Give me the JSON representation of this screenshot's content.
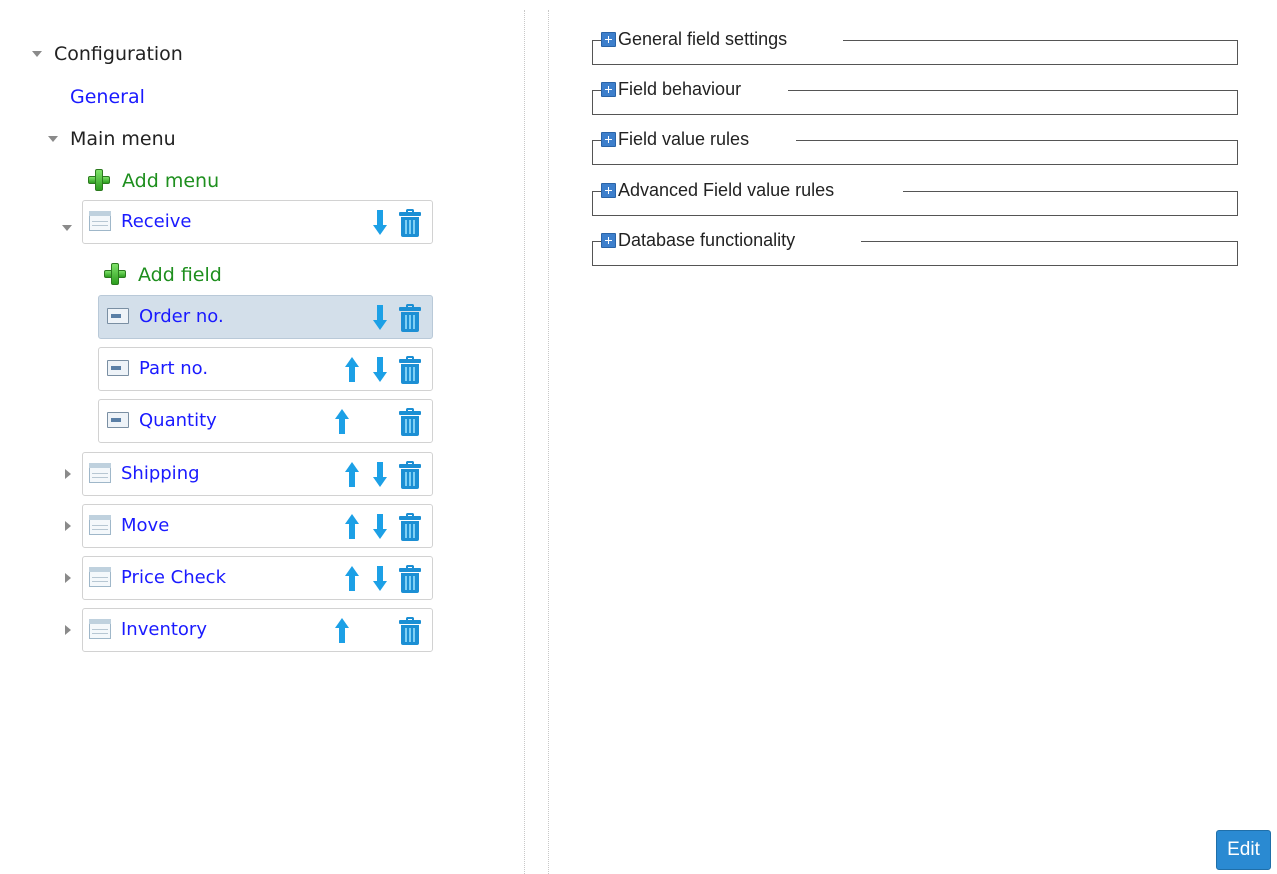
{
  "tree": {
    "configuration_label": "Configuration",
    "general_link": "General",
    "main_menu_label": "Main menu",
    "add_menu_label": "Add menu",
    "add_field_label": "Add field",
    "menus": [
      {
        "label": "Receive",
        "expanded": true,
        "icon": "table-icon"
      },
      {
        "label": "Shipping",
        "expanded": false,
        "icon": "table-icon"
      },
      {
        "label": "Move",
        "expanded": false,
        "icon": "table-icon"
      },
      {
        "label": "Price Check",
        "expanded": false,
        "icon": "table-icon"
      },
      {
        "label": "Inventory",
        "expanded": false,
        "icon": "table-icon"
      }
    ],
    "fields": [
      {
        "label": "Order no.",
        "selected": true,
        "icon": "field-icon"
      },
      {
        "label": "Part no.",
        "selected": false,
        "icon": "field-icon"
      },
      {
        "label": "Quantity",
        "selected": false,
        "icon": "field-icon"
      }
    ]
  },
  "settings_sections": [
    {
      "label": "General field settings"
    },
    {
      "label": "Field behaviour"
    },
    {
      "label": "Field value rules"
    },
    {
      "label": "Advanced Field value rules"
    },
    {
      "label": "Database functionality"
    }
  ],
  "actions": {
    "edit_label": "Edit"
  },
  "colors": {
    "link_blue": "#1a1aff",
    "add_green": "#1e8f1e",
    "arrow_blue": "#1ca0e6",
    "trash_blue": "#1c8fd4",
    "selected_bg": "#d3dfea",
    "edit_button": "#2a8ad2"
  }
}
